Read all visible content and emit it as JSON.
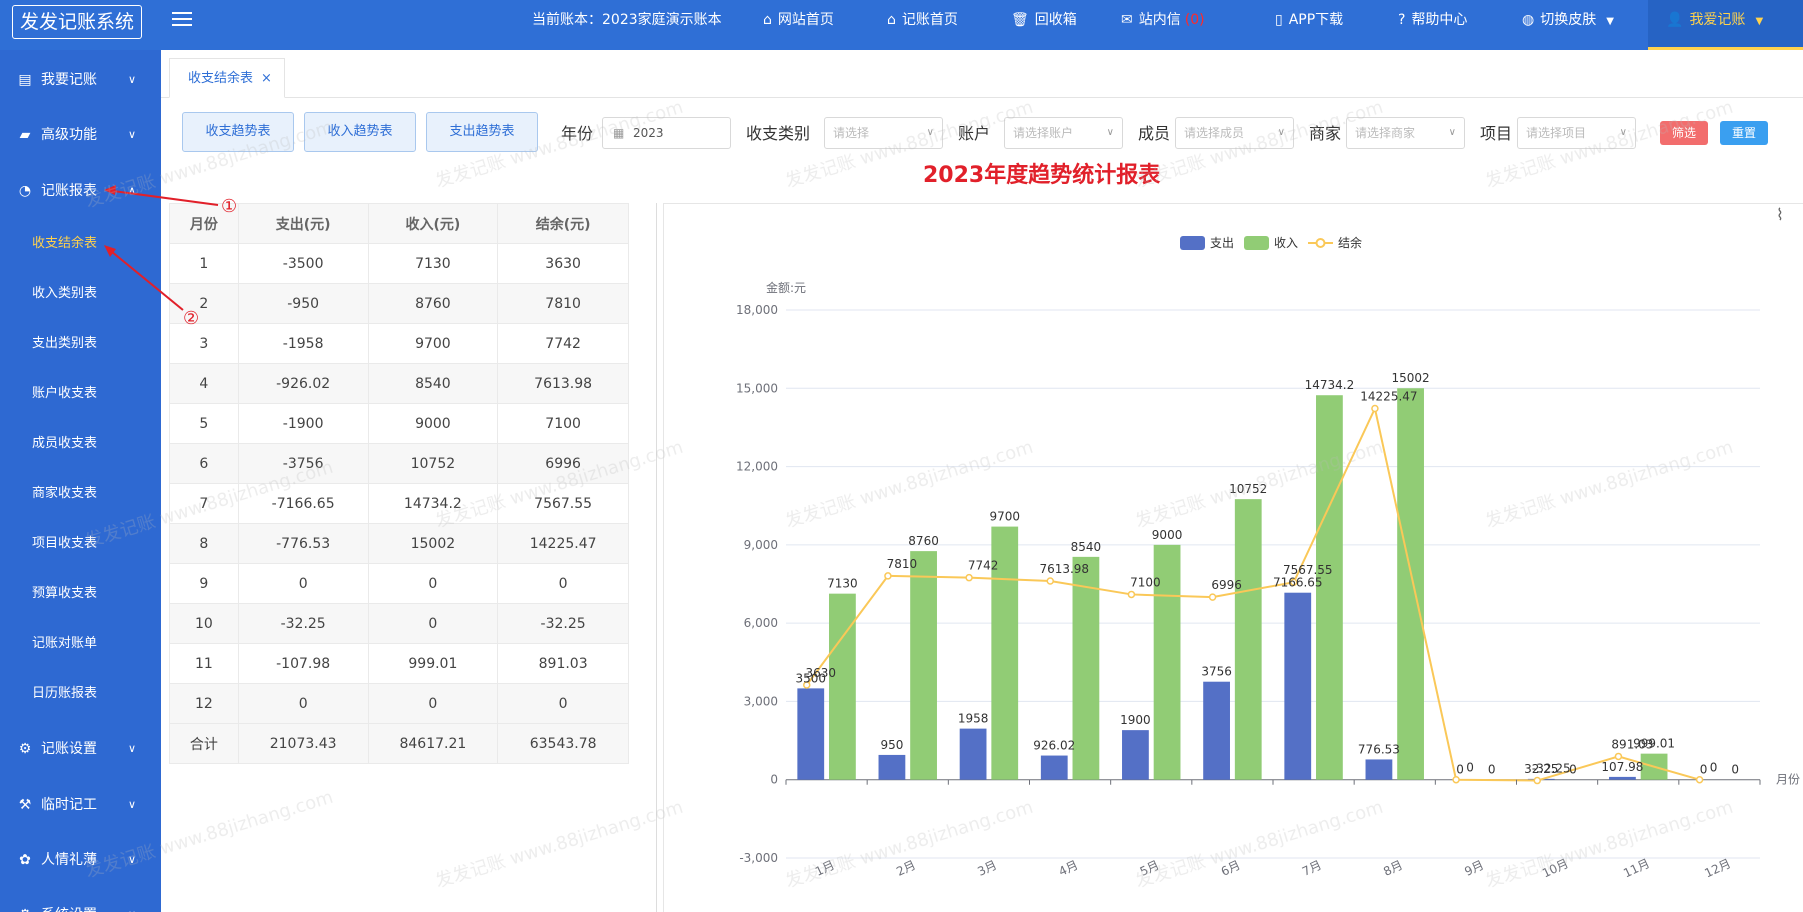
{
  "app": {
    "logo": "发发记账系统",
    "current_book": "当前账本：2023家庭演示账本"
  },
  "topnav": [
    {
      "icon": "home-icon",
      "glyph": "⌂",
      "label": "网站首页"
    },
    {
      "icon": "home-icon",
      "glyph": "⌂",
      "label": "记账首页"
    },
    {
      "icon": "trash-icon",
      "glyph": "🗑",
      "label": "回收箱"
    },
    {
      "icon": "mail-icon",
      "glyph": "✉",
      "label": "站内信"
    },
    {
      "icon": "phone-icon",
      "glyph": "▯",
      "label": "APP下载"
    },
    {
      "icon": "help-icon",
      "glyph": "?",
      "label": "帮助中心"
    },
    {
      "icon": "skin-icon",
      "glyph": "◍",
      "label": "切换皮肤"
    },
    {
      "icon": "user-icon",
      "glyph": "👤",
      "label": "我爱记账"
    }
  ],
  "topnav_msg_count": "(0)",
  "sidebar": {
    "items": [
      {
        "label": "我要记账",
        "icon": "book-icon",
        "glyph": "▤"
      },
      {
        "label": "高级功能",
        "icon": "briefcase-icon",
        "glyph": "▰"
      },
      {
        "label": "记账报表",
        "icon": "pie-icon",
        "glyph": "◔"
      },
      {
        "label": "记账设置",
        "icon": "gear-icon",
        "glyph": "⚙"
      },
      {
        "label": "临时记工",
        "icon": "tools-icon",
        "glyph": "⚒"
      },
      {
        "label": "人情礼薄",
        "icon": "gift-icon",
        "glyph": "✿"
      },
      {
        "label": "系统设置",
        "icon": "settings-icon",
        "glyph": "⚙"
      }
    ],
    "report_subitems": [
      "收支结余表",
      "收入类别表",
      "支出类别表",
      "账户收支表",
      "成员收支表",
      "商家收支表",
      "项目收支表",
      "预算收支表",
      "记账对账单",
      "日历账报表"
    ]
  },
  "tab": {
    "label": "收支结余表",
    "close": "×"
  },
  "filters": {
    "buttons": [
      "收支趋势表",
      "收入趋势表",
      "支出趋势表"
    ],
    "year_label": "年份",
    "year_value": "2023",
    "type_label": "收支类别",
    "type_placeholder": "请选择",
    "account_label": "账户",
    "account_placeholder": "请选择账户",
    "member_label": "成员",
    "member_placeholder": "请选择成员",
    "merchant_label": "商家",
    "merchant_placeholder": "请选择商家",
    "project_label": "项目",
    "project_placeholder": "请选择项目",
    "filter_btn": "筛选",
    "reset_btn": "重置",
    "filter_color": "#f26d6d",
    "reset_color": "#3a9ff0"
  },
  "report_title": "2023年度趋势统计报表",
  "table": {
    "headers": [
      "月份",
      "支出(元)",
      "收入(元)",
      "结余(元)"
    ],
    "rows": [
      [
        "1",
        "-3500",
        "7130",
        "3630"
      ],
      [
        "2",
        "-950",
        "8760",
        "7810"
      ],
      [
        "3",
        "-1958",
        "9700",
        "7742"
      ],
      [
        "4",
        "-926.02",
        "8540",
        "7613.98"
      ],
      [
        "5",
        "-1900",
        "9000",
        "7100"
      ],
      [
        "6",
        "-3756",
        "10752",
        "6996"
      ],
      [
        "7",
        "-7166.65",
        "14734.2",
        "7567.55"
      ],
      [
        "8",
        "-776.53",
        "15002",
        "14225.47"
      ],
      [
        "9",
        "0",
        "0",
        "0"
      ],
      [
        "10",
        "-32.25",
        "0",
        "-32.25"
      ],
      [
        "11",
        "-107.98",
        "999.01",
        "891.03"
      ],
      [
        "12",
        "0",
        "0",
        "0"
      ]
    ],
    "total": [
      "合计",
      "21073.43",
      "84617.21",
      "63543.78"
    ]
  },
  "annotations": [
    "①",
    "②"
  ],
  "watermark": "发发记账 www.88jizhang.com",
  "chart_data": {
    "type": "bar",
    "title": "",
    "ylabel": "金额:元",
    "xlabel": "月份",
    "ylim": [
      -3000,
      18000
    ],
    "yticks": [
      "18,000",
      "15,000",
      "12,000",
      "9,000",
      "6,000",
      "3,000",
      "0",
      "-3,000"
    ],
    "ytick_values": [
      18000,
      15000,
      12000,
      9000,
      6000,
      3000,
      0,
      -3000
    ],
    "categories": [
      "1月",
      "2月",
      "3月",
      "4月",
      "5月",
      "6月",
      "7月",
      "8月",
      "9月",
      "10月",
      "11月",
      "12月"
    ],
    "legend_position": "top-center",
    "series": [
      {
        "name": "支出",
        "type": "bar",
        "color": "#5470c6",
        "values": [
          3500,
          950,
          1958,
          926.02,
          1900,
          3756,
          7166.65,
          776.53,
          0,
          32.25,
          107.98,
          0
        ],
        "labels": [
          "3500",
          "950",
          "1958",
          "926.02",
          "1900",
          "3756",
          "7166.65",
          "776.53",
          "0",
          "32.25",
          "107.98",
          "0"
        ]
      },
      {
        "name": "收入",
        "type": "bar",
        "color": "#91cc75",
        "values": [
          7130,
          8760,
          9700,
          8540,
          9000,
          10752,
          14734.2,
          15002,
          0,
          0,
          999.01,
          0
        ],
        "labels": [
          "7130",
          "8760",
          "9700",
          "8540",
          "9000",
          "10752",
          "14734.2",
          "15002",
          "0",
          "0",
          "999.01",
          "0"
        ]
      },
      {
        "name": "结余",
        "type": "line",
        "color": "#fac858",
        "values": [
          3630,
          7810,
          7742,
          7613.98,
          7100,
          6996,
          7567.55,
          14225.47,
          0,
          -32.25,
          891.03,
          0
        ],
        "labels": [
          "3630",
          "7810",
          "7742",
          "7613.98",
          "7100",
          "6996",
          "7567.55",
          "14225.47",
          "0",
          "-32.25",
          "891.03",
          "0"
        ]
      }
    ]
  }
}
